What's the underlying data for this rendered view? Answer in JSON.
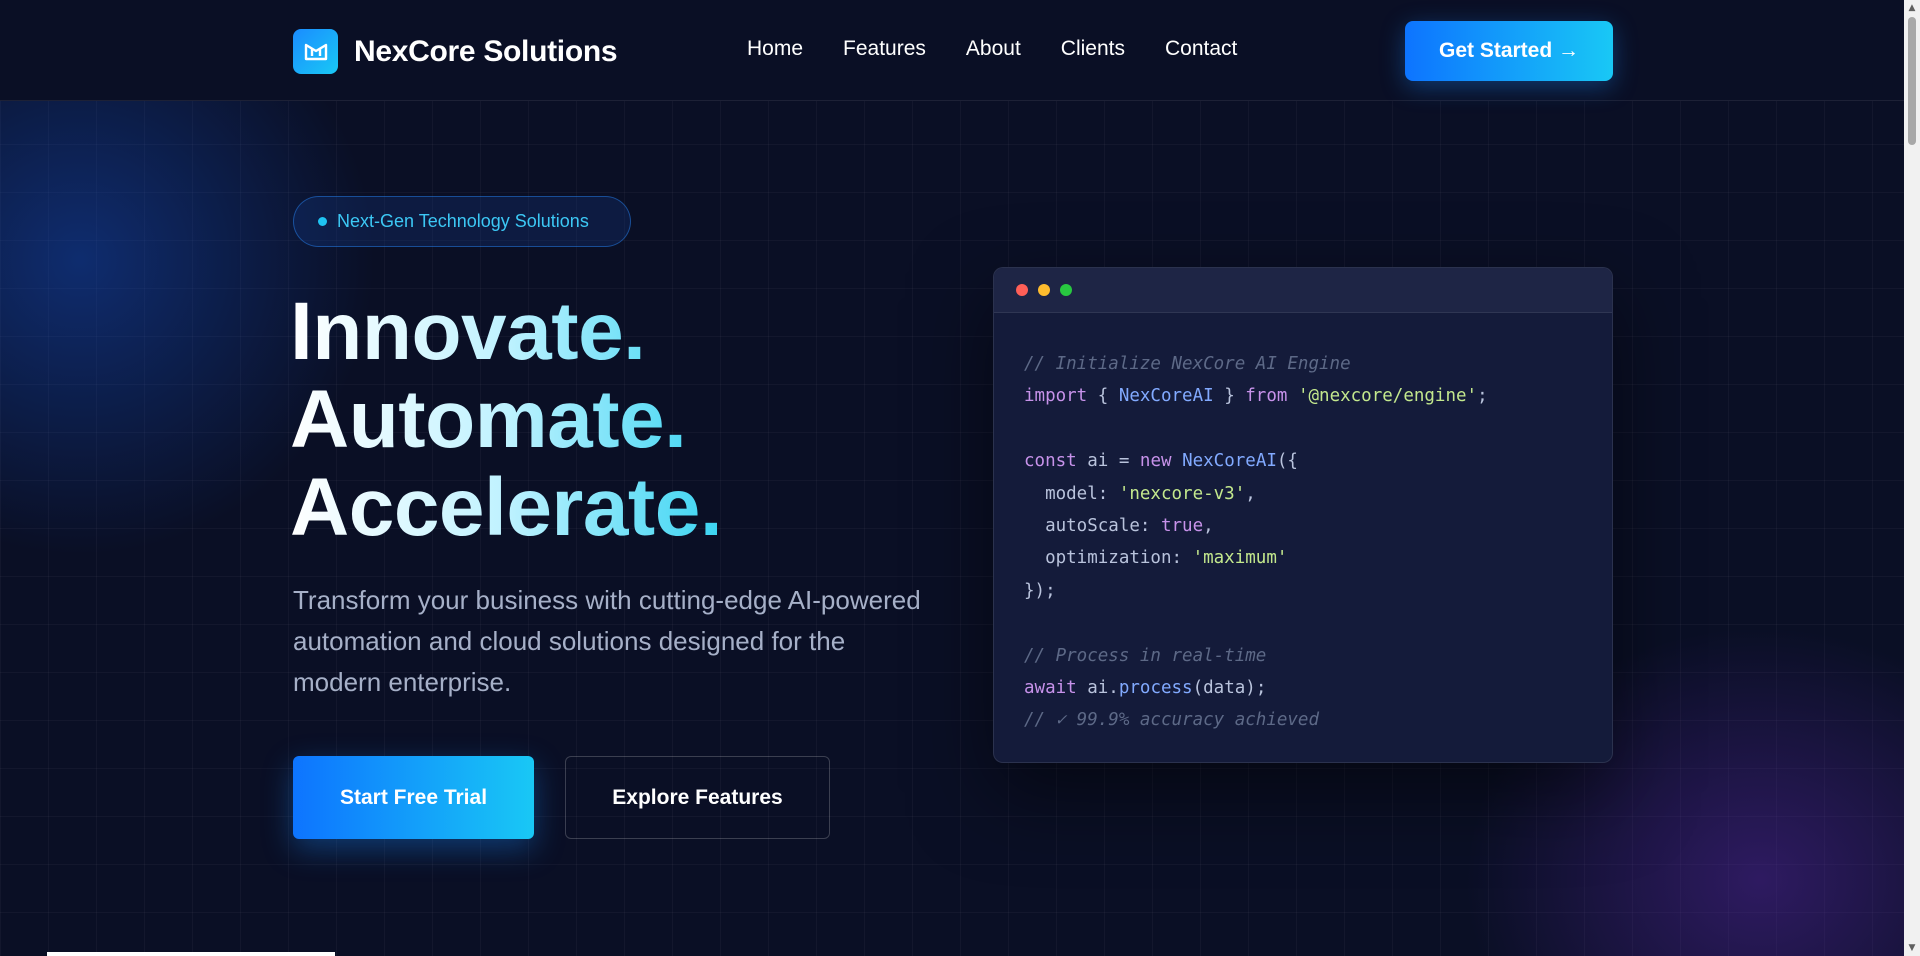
{
  "header": {
    "brand": "NexCore Solutions",
    "nav": [
      {
        "label": "Home"
      },
      {
        "label": "Features"
      },
      {
        "label": "About"
      },
      {
        "label": "Clients"
      },
      {
        "label": "Contact"
      }
    ],
    "cta_label": "Get Started →"
  },
  "hero": {
    "badge": "Next-Gen Technology Solutions",
    "headline": [
      "Innovate.",
      "Automate.",
      "Accelerate."
    ],
    "subtitle": "Transform your business with cutting-edge AI-powered automation and cloud solutions designed for the modern enterprise.",
    "primary_button": "Start Free Trial",
    "secondary_button": "Explore Features"
  },
  "code_window": {
    "dots": [
      "#ff5f57",
      "#febc2e",
      "#28c840"
    ],
    "comment1": "// Initialize NexCore AI Engine",
    "import_kw": "import",
    "import_open": " { ",
    "import_name": "NexCoreAI",
    "import_close": " } ",
    "from_kw": "from",
    "module": "'@nexcore/engine'",
    "semicolon": ";",
    "const_kw": "const",
    "const_mid": " ai = ",
    "new_kw": "new",
    "class_name": "NexCoreAI",
    "open_call": "({",
    "model_key": "  model: ",
    "model_val": "'nexcore-v3'",
    "model_comma": ",",
    "auto_key": "  autoScale: ",
    "auto_val": "true",
    "auto_comma": ",",
    "opt_key": "  optimization: ",
    "opt_val": "'maximum'",
    "close_call": "});",
    "comment2": "// Process in real-time",
    "await_kw": "await",
    "await_obj": " ai.",
    "await_fn": "process",
    "await_args": "(data);",
    "comment3": "// ✓ 99.9% accuracy achieved"
  },
  "colors": {
    "accent": "#1a8cff",
    "accent_cyan": "#19c8f5",
    "background": "#0a0f25"
  }
}
